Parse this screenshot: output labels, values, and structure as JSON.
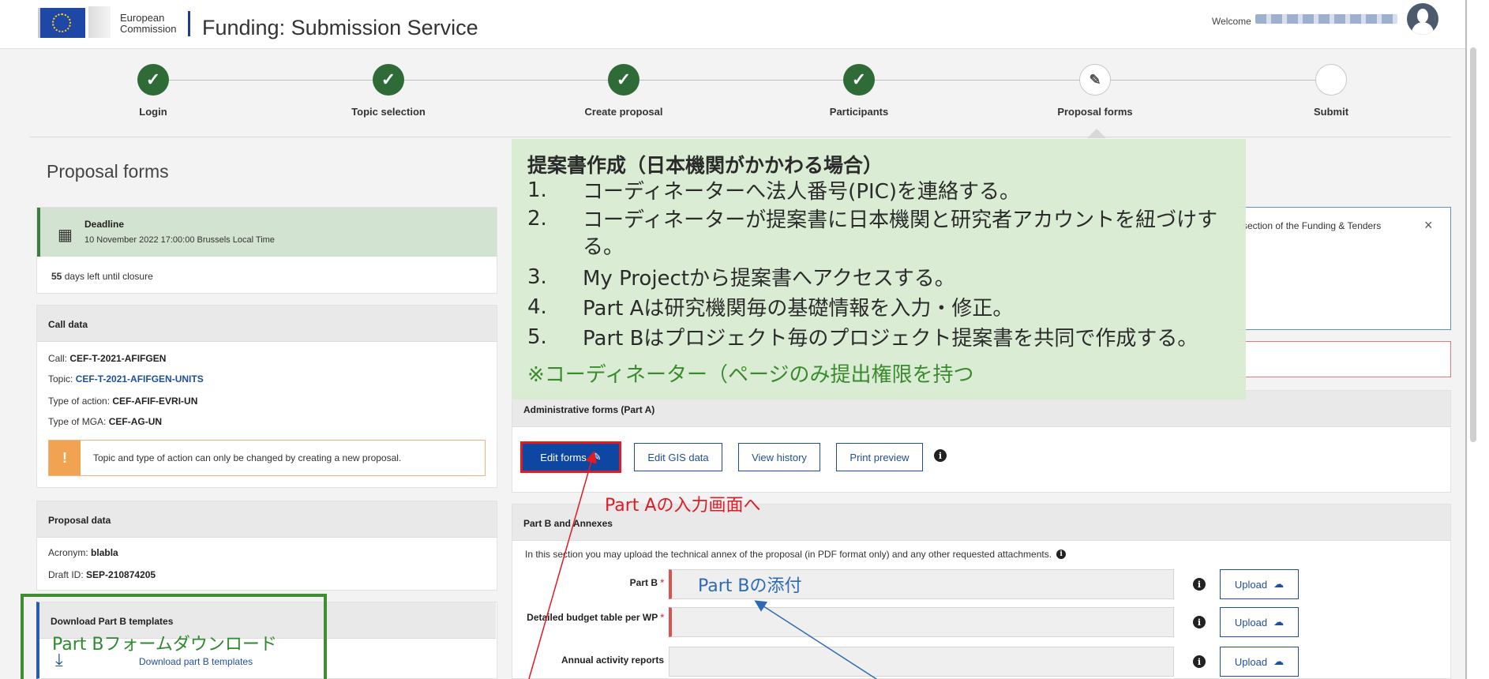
{
  "header": {
    "org_line1": "European",
    "org_line2": "Commission",
    "app_title": "Funding: Submission Service",
    "welcome": "Welcome"
  },
  "steps": [
    {
      "label": "Login",
      "state": "done"
    },
    {
      "label": "Topic selection",
      "state": "done"
    },
    {
      "label": "Create proposal",
      "state": "done"
    },
    {
      "label": "Participants",
      "state": "done"
    },
    {
      "label": "Proposal forms",
      "state": "current"
    },
    {
      "label": "Submit",
      "state": "todo"
    }
  ],
  "page_title": "Proposal forms",
  "deadline": {
    "label": "Deadline",
    "date": "10 November 2022 17:00:00 Brussels Local Time",
    "days_number": "55",
    "days_text": "days left until closure"
  },
  "call_data": {
    "title": "Call data",
    "call_label": "Call:",
    "call_value": "CEF-T-2021-AFIFGEN",
    "topic_label": "Topic:",
    "topic_value": "CEF-T-2021-AFIFGEN-UNITS",
    "action_label": "Type of action:",
    "action_value": "CEF-AFIF-EVRI-UN",
    "mga_label": "Type of MGA:",
    "mga_value": "CEF-AG-UN",
    "warning": "Topic and type of action can only be changed by creating a new proposal."
  },
  "proposal_data": {
    "title": "Proposal data",
    "acronym_label": "Acronym:",
    "acronym_value": "blabla",
    "draft_label": "Draft ID:",
    "draft_value": "SEP-210874205"
  },
  "download": {
    "title": "Download Part B templates",
    "link": "Download part B templates"
  },
  "info_panel": {
    "text": "section of the Funding & Tenders",
    "close": "×"
  },
  "admin": {
    "title": "Administrative forms (Part A)",
    "edit": "Edit forms",
    "gis": "Edit GIS data",
    "history": "View history",
    "preview": "Print preview"
  },
  "partb": {
    "title": "Part B and Annexes",
    "description": "In this section you may upload the technical annex of the proposal (in PDF format only) and any other requested attachments.",
    "rows": [
      {
        "label": "Part B",
        "required": "*",
        "upload": "Upload"
      },
      {
        "label": "Detailed budget table per WP",
        "required": "*",
        "upload": "Upload"
      },
      {
        "label": "Annual activity reports",
        "required": "",
        "upload": "Upload"
      }
    ]
  },
  "annotation": {
    "title": "提案書作成（日本機関がかかわる場合）",
    "items": [
      {
        "num": "1.",
        "text": "コーディネーターへ法人番号(PIC)を連絡する。"
      },
      {
        "num": "2.",
        "text": "コーディネーターが提案書に日本機関と研究者アカウントを紐づけする。"
      },
      {
        "num": "3.",
        "text": "My Projectから提案書へアクセスする。"
      },
      {
        "num": "4.",
        "text": "Part Aは研究機関毎の基礎情報を入力・修正。"
      },
      {
        "num": "5.",
        "text": "Part Bはプロジェクト毎のプロジェクト提案書を共同で作成する。"
      }
    ],
    "note": "※コーディネーター（ページのみ提出権限を持つ",
    "callout_red": "Part Aの入力画面へ",
    "callout_blue": "Part Bの添付",
    "callout_green": "Part Bフォームダウンロード"
  },
  "colors": {
    "step_done": "#2e6b36",
    "primary_button": "#0e47a1",
    "annotation_bg": "#d9ebd3",
    "callout_red": "#e01b24",
    "callout_blue": "#2f6ab5",
    "callout_green": "#2e8a2e"
  },
  "icons": {
    "step_done": "check-icon",
    "step_current": "pencil-icon",
    "deadline": "calendar-icon",
    "warning": "warning-icon",
    "download": "download-icon",
    "upload": "cloud-upload-icon",
    "info": "info-icon"
  }
}
